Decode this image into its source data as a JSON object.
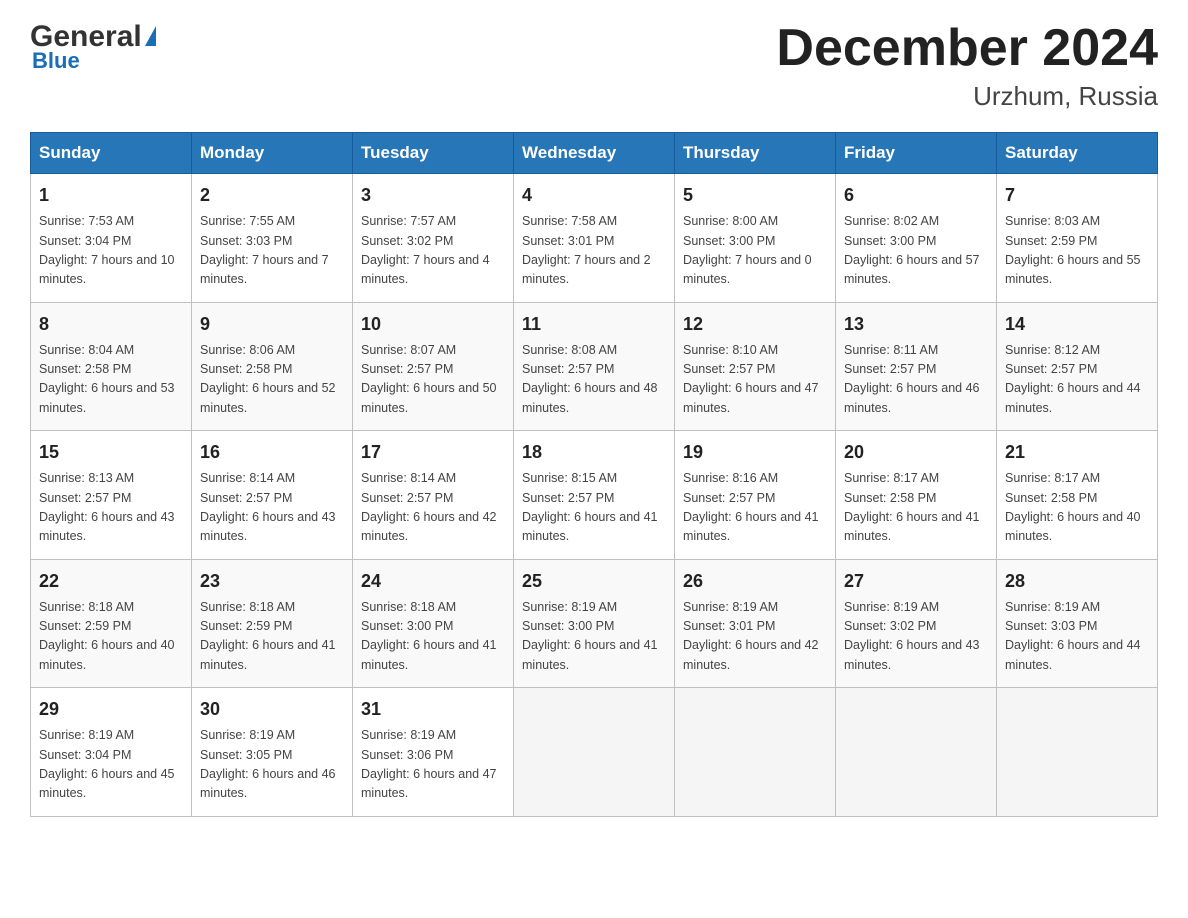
{
  "header": {
    "logo_general": "General",
    "logo_blue": "Blue",
    "month_title": "December 2024",
    "location": "Urzhum, Russia"
  },
  "weekdays": [
    "Sunday",
    "Monday",
    "Tuesday",
    "Wednesday",
    "Thursday",
    "Friday",
    "Saturday"
  ],
  "weeks": [
    [
      {
        "day": "1",
        "sunrise": "7:53 AM",
        "sunset": "3:04 PM",
        "daylight": "7 hours and 10 minutes."
      },
      {
        "day": "2",
        "sunrise": "7:55 AM",
        "sunset": "3:03 PM",
        "daylight": "7 hours and 7 minutes."
      },
      {
        "day": "3",
        "sunrise": "7:57 AM",
        "sunset": "3:02 PM",
        "daylight": "7 hours and 4 minutes."
      },
      {
        "day": "4",
        "sunrise": "7:58 AM",
        "sunset": "3:01 PM",
        "daylight": "7 hours and 2 minutes."
      },
      {
        "day": "5",
        "sunrise": "8:00 AM",
        "sunset": "3:00 PM",
        "daylight": "7 hours and 0 minutes."
      },
      {
        "day": "6",
        "sunrise": "8:02 AM",
        "sunset": "3:00 PM",
        "daylight": "6 hours and 57 minutes."
      },
      {
        "day": "7",
        "sunrise": "8:03 AM",
        "sunset": "2:59 PM",
        "daylight": "6 hours and 55 minutes."
      }
    ],
    [
      {
        "day": "8",
        "sunrise": "8:04 AM",
        "sunset": "2:58 PM",
        "daylight": "6 hours and 53 minutes."
      },
      {
        "day": "9",
        "sunrise": "8:06 AM",
        "sunset": "2:58 PM",
        "daylight": "6 hours and 52 minutes."
      },
      {
        "day": "10",
        "sunrise": "8:07 AM",
        "sunset": "2:57 PM",
        "daylight": "6 hours and 50 minutes."
      },
      {
        "day": "11",
        "sunrise": "8:08 AM",
        "sunset": "2:57 PM",
        "daylight": "6 hours and 48 minutes."
      },
      {
        "day": "12",
        "sunrise": "8:10 AM",
        "sunset": "2:57 PM",
        "daylight": "6 hours and 47 minutes."
      },
      {
        "day": "13",
        "sunrise": "8:11 AM",
        "sunset": "2:57 PM",
        "daylight": "6 hours and 46 minutes."
      },
      {
        "day": "14",
        "sunrise": "8:12 AM",
        "sunset": "2:57 PM",
        "daylight": "6 hours and 44 minutes."
      }
    ],
    [
      {
        "day": "15",
        "sunrise": "8:13 AM",
        "sunset": "2:57 PM",
        "daylight": "6 hours and 43 minutes."
      },
      {
        "day": "16",
        "sunrise": "8:14 AM",
        "sunset": "2:57 PM",
        "daylight": "6 hours and 43 minutes."
      },
      {
        "day": "17",
        "sunrise": "8:14 AM",
        "sunset": "2:57 PM",
        "daylight": "6 hours and 42 minutes."
      },
      {
        "day": "18",
        "sunrise": "8:15 AM",
        "sunset": "2:57 PM",
        "daylight": "6 hours and 41 minutes."
      },
      {
        "day": "19",
        "sunrise": "8:16 AM",
        "sunset": "2:57 PM",
        "daylight": "6 hours and 41 minutes."
      },
      {
        "day": "20",
        "sunrise": "8:17 AM",
        "sunset": "2:58 PM",
        "daylight": "6 hours and 41 minutes."
      },
      {
        "day": "21",
        "sunrise": "8:17 AM",
        "sunset": "2:58 PM",
        "daylight": "6 hours and 40 minutes."
      }
    ],
    [
      {
        "day": "22",
        "sunrise": "8:18 AM",
        "sunset": "2:59 PM",
        "daylight": "6 hours and 40 minutes."
      },
      {
        "day": "23",
        "sunrise": "8:18 AM",
        "sunset": "2:59 PM",
        "daylight": "6 hours and 41 minutes."
      },
      {
        "day": "24",
        "sunrise": "8:18 AM",
        "sunset": "3:00 PM",
        "daylight": "6 hours and 41 minutes."
      },
      {
        "day": "25",
        "sunrise": "8:19 AM",
        "sunset": "3:00 PM",
        "daylight": "6 hours and 41 minutes."
      },
      {
        "day": "26",
        "sunrise": "8:19 AM",
        "sunset": "3:01 PM",
        "daylight": "6 hours and 42 minutes."
      },
      {
        "day": "27",
        "sunrise": "8:19 AM",
        "sunset": "3:02 PM",
        "daylight": "6 hours and 43 minutes."
      },
      {
        "day": "28",
        "sunrise": "8:19 AM",
        "sunset": "3:03 PM",
        "daylight": "6 hours and 44 minutes."
      }
    ],
    [
      {
        "day": "29",
        "sunrise": "8:19 AM",
        "sunset": "3:04 PM",
        "daylight": "6 hours and 45 minutes."
      },
      {
        "day": "30",
        "sunrise": "8:19 AM",
        "sunset": "3:05 PM",
        "daylight": "6 hours and 46 minutes."
      },
      {
        "day": "31",
        "sunrise": "8:19 AM",
        "sunset": "3:06 PM",
        "daylight": "6 hours and 47 minutes."
      },
      null,
      null,
      null,
      null
    ]
  ]
}
